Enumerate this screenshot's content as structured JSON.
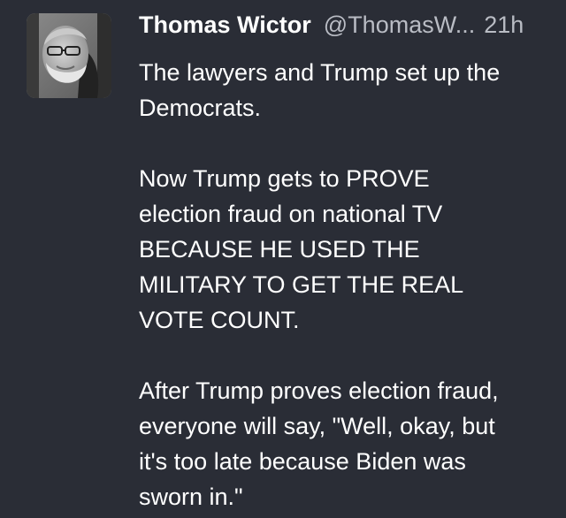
{
  "tweet": {
    "author": {
      "display_name": "Thomas Wictor",
      "handle": "@ThomasW...",
      "avatar_icon": "profile-photo-grayscale-bearded-man"
    },
    "timestamp": "21h",
    "paragraphs": [
      {
        "lines": [
          "The lawyers and Trump set up the",
          "Democrats."
        ]
      },
      {
        "lines": [
          "Now Trump gets to PROVE",
          "election fraud on national TV",
          "BECAUSE HE USED THE",
          "MILITARY TO GET THE REAL",
          "VOTE COUNT."
        ]
      },
      {
        "lines": [
          "After Trump proves election fraud,",
          "everyone will say, \"Well, okay, but",
          "it's too late because Biden was",
          "sworn in.\""
        ]
      }
    ]
  },
  "colors": {
    "background": "#2a2d36",
    "primary_text": "#ffffff",
    "secondary_text": "#b9bcc4"
  }
}
